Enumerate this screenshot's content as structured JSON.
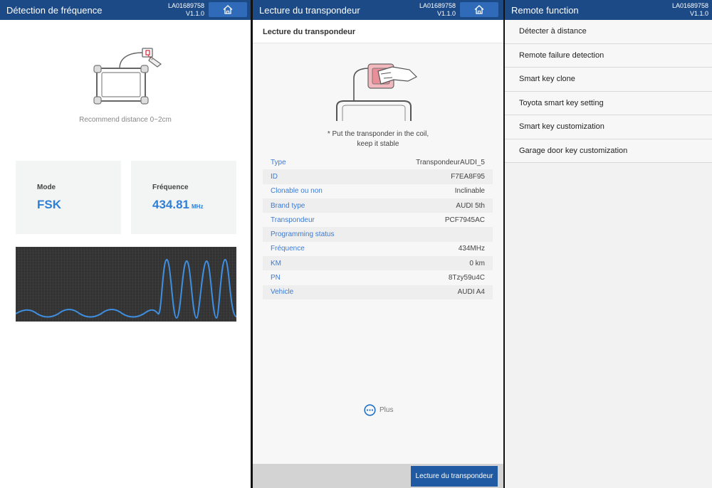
{
  "panel1": {
    "title": "Détection de fréquence",
    "serial": "LA01689758",
    "version": "V1.1.0",
    "home_icon": "home-icon",
    "distance_text": "Recommend distance 0~2cm",
    "mode_label": "Mode",
    "mode_value": "FSK",
    "freq_label": "Fréquence",
    "freq_value": "434.81",
    "freq_unit": "MHz"
  },
  "panel2": {
    "title": "Lecture du transpondeur",
    "serial": "LA01689758",
    "version": "V1.1.0",
    "home_icon": "home-icon",
    "subheader": "Lecture du transpondeur",
    "instruction_line1": "* Put the transponder in the coil,",
    "instruction_line2": "keep it stable",
    "rows": [
      {
        "key": "Type",
        "value": "TranspondeurAUDI_5"
      },
      {
        "key": "ID",
        "value": "F7EA8F95"
      },
      {
        "key": "Clonable ou non",
        "value": "Inclinable"
      },
      {
        "key": "Brand type",
        "value": "AUDI 5th"
      },
      {
        "key": "Transpondeur",
        "value": "PCF7945AC"
      },
      {
        "key": "Programming status",
        "value": ""
      },
      {
        "key": "Fréquence",
        "value": "434MHz"
      },
      {
        "key": "KM",
        "value": "0 km"
      },
      {
        "key": "PN",
        "value": "8Tzy59u4C"
      },
      {
        "key": "Vehicle",
        "value": "AUDI A4"
      }
    ],
    "more_icon": "more-dots-icon",
    "more_label": "Plus",
    "read_button": "Lecture du transpondeur"
  },
  "panel3": {
    "title": "Remote function",
    "serial": "LA01689758",
    "version": "V1.1.0",
    "menu": [
      "Détecter à distance",
      "Remote failure detection",
      "Smart key clone",
      "Toyota smart key setting",
      "Smart key customization",
      "Garage door key customization"
    ]
  },
  "colors": {
    "header": "#1c4a86",
    "accent": "#2f7fd6",
    "button": "#1f5aa3"
  }
}
